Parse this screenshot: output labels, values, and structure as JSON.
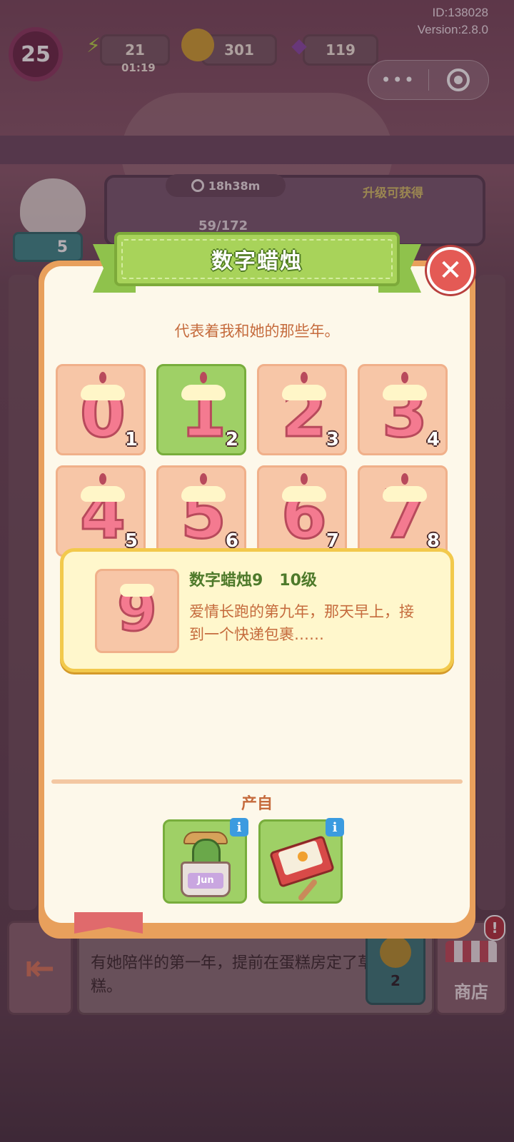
{
  "status": {
    "id_text": "ID:138028",
    "version_text": "Version:2.8.0",
    "player_level": "25",
    "energy": "21",
    "energy_timer": "01:19",
    "coins": "301",
    "gems": "119",
    "more_glyph": "•••"
  },
  "background": {
    "timer": "18h38m",
    "upgrade_rewards_label": "升级可获得",
    "progress": "59/172",
    "bird_count": "5",
    "desc_text": "有她陪伴的第一年，提前在蛋糕房定了草莓蛋糕。",
    "coin_cost": "2",
    "shop_label": "商店",
    "shop_alert": "!"
  },
  "dialog": {
    "title": "数字蜡烛",
    "close_glyph": "✕",
    "subtitle": "代表着我和她的那些年。",
    "items": [
      {
        "digit": "0",
        "level": "1",
        "selected": false
      },
      {
        "digit": "1",
        "level": "2",
        "selected": true
      },
      {
        "digit": "2",
        "level": "3",
        "selected": false
      },
      {
        "digit": "3",
        "level": "4",
        "selected": false
      },
      {
        "digit": "4",
        "level": "5",
        "selected": false
      },
      {
        "digit": "5",
        "level": "6",
        "selected": false
      },
      {
        "digit": "6",
        "level": "7",
        "selected": false
      },
      {
        "digit": "7",
        "level": "8",
        "selected": false
      }
    ],
    "popup": {
      "digit": "9",
      "title": "数字蜡烛9",
      "level": "10级",
      "desc": "爱情长跑的第九年，那天早上，接到一个快递包裹……"
    },
    "produced_label": "产自",
    "sources": [
      {
        "name": "cactus-pot",
        "pot_text": "Jun"
      },
      {
        "name": "matchbox"
      }
    ],
    "info_glyph": "i"
  },
  "colors": {
    "ribbon_green": "#a8d35a",
    "panel_cream": "#fdf8ea",
    "panel_border": "#e8a05c",
    "candle_pink": "#f47a90",
    "text_brown": "#c56b3d",
    "close_red": "#e45a55"
  }
}
